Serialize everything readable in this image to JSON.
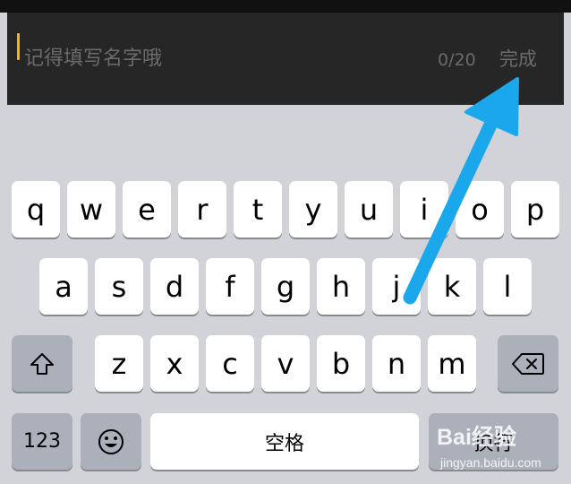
{
  "input": {
    "placeholder": "记得填写名字哦",
    "counter": "0/20",
    "done_label": "完成"
  },
  "keyboard": {
    "row1": [
      "q",
      "w",
      "e",
      "r",
      "t",
      "y",
      "u",
      "i",
      "o",
      "p"
    ],
    "row2": [
      "a",
      "s",
      "d",
      "f",
      "g",
      "h",
      "j",
      "k",
      "l"
    ],
    "row3": [
      "z",
      "x",
      "c",
      "v",
      "b",
      "n",
      "m"
    ],
    "numbers_label": "123",
    "space_label": "空格",
    "return_label": "换行"
  },
  "colors": {
    "input_bar": "#262626",
    "caret": "#f3b51e",
    "keyboard_bg": "#d1d3d9",
    "arrow": "#1aa7ec"
  },
  "watermark": {
    "logo": "Bai经验",
    "url": "jingyan.baidu.com"
  }
}
